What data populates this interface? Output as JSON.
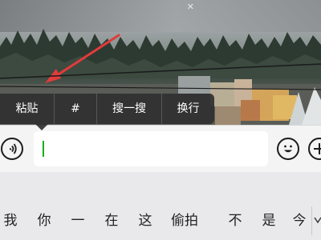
{
  "context_menu": {
    "items": [
      {
        "label": "粘贴"
      },
      {
        "label": "#"
      },
      {
        "label": "搜一搜"
      },
      {
        "label": "换行"
      }
    ]
  },
  "input": {
    "value": ""
  },
  "keyboard": {
    "candidates": [
      "我",
      "你",
      "一",
      "在",
      "这",
      "偷拍",
      "不",
      "是",
      "今"
    ]
  },
  "icons": {
    "voice": "voice-icon",
    "emoji": "emoji-icon",
    "plus": "plus-icon",
    "expand": "chevron-down-icon",
    "close": "close-icon",
    "annotation": "arrow-annotation"
  },
  "colors": {
    "menu_bg": "#303030",
    "cursor": "#1aad19",
    "annotation_arrow": "#e23b3b"
  }
}
